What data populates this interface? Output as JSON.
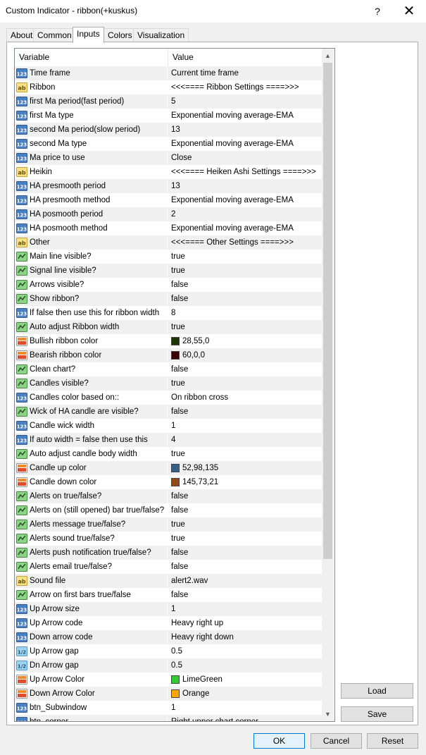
{
  "window": {
    "title": "Custom Indicator - ribbon(+kuskus)",
    "help_glyph": "?",
    "close_glyph": "✕"
  },
  "tabs": [
    {
      "label": "About",
      "active": false
    },
    {
      "label": "Common",
      "active": false
    },
    {
      "label": "Inputs",
      "active": true
    },
    {
      "label": "Colors",
      "active": false
    },
    {
      "label": "Visualization",
      "active": false
    }
  ],
  "grid": {
    "header": {
      "variable": "Variable",
      "value": "Value"
    },
    "rows": [
      {
        "type": "int",
        "name": "Time frame",
        "value": "Current time frame"
      },
      {
        "type": "str",
        "name": "Ribbon",
        "value": "<<<====  Ribbon Settings ====>>>"
      },
      {
        "type": "int",
        "name": "first Ma period(fast period)",
        "value": "5"
      },
      {
        "type": "int",
        "name": "first Ma type",
        "value": "Exponential moving average-EMA"
      },
      {
        "type": "int",
        "name": "second Ma period(slow period)",
        "value": "13"
      },
      {
        "type": "int",
        "name": "second Ma type",
        "value": "Exponential moving average-EMA"
      },
      {
        "type": "int",
        "name": "Ma price to use",
        "value": "Close"
      },
      {
        "type": "str",
        "name": "Heikin",
        "value": "<<<====  Heiken Ashi Settings ====>>>"
      },
      {
        "type": "int",
        "name": "HA presmooth period",
        "value": "13"
      },
      {
        "type": "int",
        "name": "HA presmooth method",
        "value": "Exponential moving average-EMA"
      },
      {
        "type": "int",
        "name": "HA posmooth period",
        "value": "2"
      },
      {
        "type": "int",
        "name": "HA posmooth method",
        "value": "Exponential moving average-EMA"
      },
      {
        "type": "str",
        "name": "Other",
        "value": "<<<====  Other Settings ====>>>"
      },
      {
        "type": "bool",
        "name": "Main line visible?",
        "value": "true"
      },
      {
        "type": "bool",
        "name": "Signal line visible?",
        "value": "true"
      },
      {
        "type": "bool",
        "name": "Arrows visible?",
        "value": "false"
      },
      {
        "type": "bool",
        "name": "Show ribbon?",
        "value": "false"
      },
      {
        "type": "int",
        "name": "If  false then use this for ribbon width",
        "value": "8"
      },
      {
        "type": "bool",
        "name": "Auto adjust Ribbon width",
        "value": "true"
      },
      {
        "type": "color",
        "name": "Bullish ribbon  color",
        "value": "28,55,0",
        "swatch": "#1c3700"
      },
      {
        "type": "color",
        "name": "Bearish ribbon  color",
        "value": "60,0,0",
        "swatch": "#3c0000"
      },
      {
        "type": "bool",
        "name": "Clean chart?",
        "value": "false"
      },
      {
        "type": "bool",
        "name": "Candles visible?",
        "value": "true"
      },
      {
        "type": "int",
        "name": "Candles color based on::",
        "value": "On ribbon cross"
      },
      {
        "type": "bool",
        "name": "Wick of HA candle are visible?",
        "value": "false"
      },
      {
        "type": "int",
        "name": "Candle wick width",
        "value": "1"
      },
      {
        "type": "int",
        "name": "If auto width = false then use this",
        "value": "4"
      },
      {
        "type": "bool",
        "name": "Auto adjust candle body width",
        "value": "true"
      },
      {
        "type": "color",
        "name": "Candle up color",
        "value": "52,98,135",
        "swatch": "#346287"
      },
      {
        "type": "color",
        "name": "Candle down color",
        "value": "145,73,21",
        "swatch": "#914915"
      },
      {
        "type": "bool",
        "name": "Alerts on true/false?",
        "value": "false"
      },
      {
        "type": "bool",
        "name": "Alerts on (still opened) bar true/false?",
        "value": "false"
      },
      {
        "type": "bool",
        "name": "Alerts message true/false?",
        "value": "true"
      },
      {
        "type": "bool",
        "name": "Alerts sound true/false?",
        "value": "true"
      },
      {
        "type": "bool",
        "name": "Alerts push notification true/false?",
        "value": "false"
      },
      {
        "type": "bool",
        "name": "Alerts email true/false?",
        "value": "false"
      },
      {
        "type": "str",
        "name": "Sound file",
        "value": "alert2.wav"
      },
      {
        "type": "bool",
        "name": "Arrow on first bars true/false",
        "value": "false"
      },
      {
        "type": "int",
        "name": "Up Arrow size",
        "value": "1"
      },
      {
        "type": "int",
        "name": "Up Arrow code",
        "value": "Heavy right up"
      },
      {
        "type": "int",
        "name": "Down arrow code",
        "value": "Heavy right down"
      },
      {
        "type": "dbl",
        "name": "Up Arrow gap",
        "value": "0.5"
      },
      {
        "type": "dbl",
        "name": "Dn Arrow gap",
        "value": "0.5"
      },
      {
        "type": "color",
        "name": "Up Arrow Color",
        "value": "LimeGreen",
        "swatch": "#32cd32"
      },
      {
        "type": "color",
        "name": "Down Arrow Color",
        "value": "Orange",
        "swatch": "#ffa500"
      },
      {
        "type": "int",
        "name": "btn_Subwindow",
        "value": "1"
      },
      {
        "type": "int",
        "name": "btn_corner",
        "value": "Right upper chart corner"
      }
    ]
  },
  "buttons": {
    "load": "Load",
    "save": "Save",
    "ok": "OK",
    "cancel": "Cancel",
    "reset": "Reset"
  },
  "icons": {
    "int": "int-param-icon",
    "str": "string-param-icon",
    "bool": "bool-param-icon",
    "color": "color-param-icon",
    "dbl": "double-param-icon"
  },
  "scrollbar": {
    "up": "▲",
    "down": "▼",
    "visible_fraction": 0.77
  }
}
